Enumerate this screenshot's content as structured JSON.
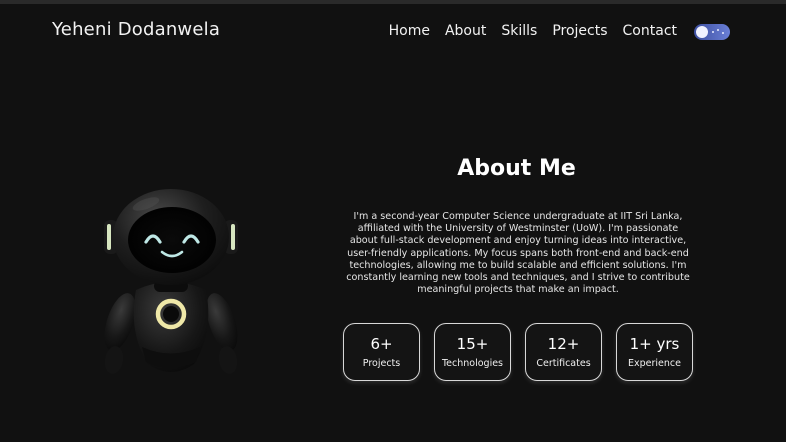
{
  "header": {
    "brand": "Yeheni Dodanwela",
    "nav": [
      "Home",
      "About",
      "Skills",
      "Projects",
      "Contact"
    ]
  },
  "theme_toggle": {
    "state": "dark",
    "accent_colors": [
      "#3d4fa0",
      "#6a7fd6"
    ]
  },
  "about": {
    "title": "About Me",
    "text": "I'm a second-year Computer Science undergraduate at IIT Sri Lanka, affiliated with the University of Westminster (UoW). I'm passionate about full-stack development and enjoy turning ideas into interactive, user-friendly applications. My focus spans both front-end and back-end technologies, allowing me to build scalable and efficient solutions. I'm constantly learning new tools and techniques, and I strive to contribute meaningful projects that make an impact."
  },
  "stats": [
    {
      "value": "6+",
      "label": "Projects"
    },
    {
      "value": "15+",
      "label": "Technologies"
    },
    {
      "value": "12+",
      "label": "Certificates"
    },
    {
      "value": "1+ yrs",
      "label": "Experience"
    }
  ],
  "illustration": {
    "name": "robot-illustration",
    "accent_color": "#e8e0a0"
  },
  "colors": {
    "background": "#111111",
    "text": "#ffffff",
    "card_border": "#d8d8d8"
  }
}
